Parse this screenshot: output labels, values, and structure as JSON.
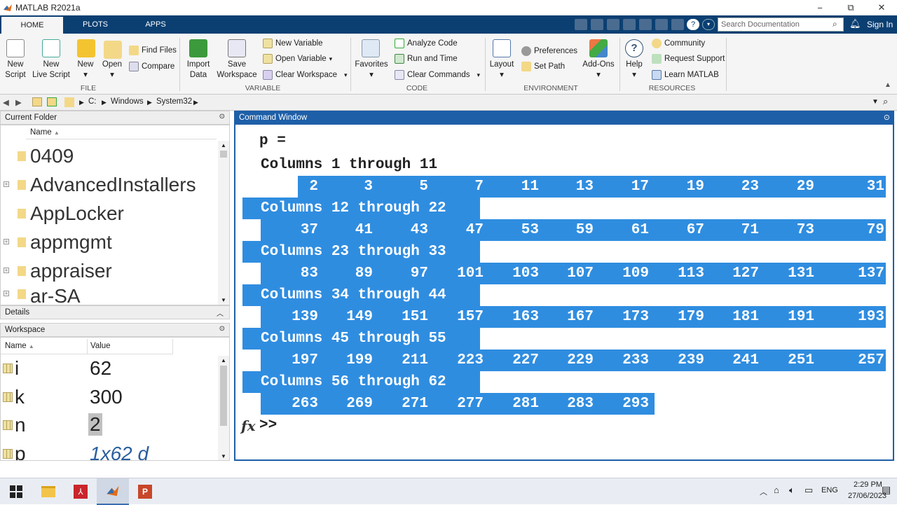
{
  "window": {
    "title": "MATLAB R2021a",
    "controls": {
      "minimize": "−",
      "maximize": "⧉",
      "close": "✕"
    }
  },
  "tabs": [
    "HOME",
    "PLOTS",
    "APPS"
  ],
  "search": {
    "placeholder": "Search Documentation"
  },
  "account": {
    "sign_in": "Sign In"
  },
  "ribbon": {
    "file": {
      "new_script": [
        "New",
        "Script"
      ],
      "new_live_script": [
        "New",
        "Live Script"
      ],
      "new": "New",
      "open": "Open",
      "find_files": "Find Files",
      "compare": "Compare",
      "label": "FILE"
    },
    "variable": {
      "import_data": [
        "Import",
        "Data"
      ],
      "save_workspace": [
        "Save",
        "Workspace"
      ],
      "new_variable": "New Variable",
      "open_variable": "Open Variable",
      "clear_workspace": "Clear Workspace",
      "label": "VARIABLE"
    },
    "code": {
      "favorites": "Favorites",
      "analyze_code": "Analyze Code",
      "run_and_time": "Run and Time",
      "clear_commands": "Clear Commands",
      "label": "CODE"
    },
    "environment": {
      "layout": "Layout",
      "preferences": "Preferences",
      "set_path": "Set Path",
      "addons": "Add-Ons",
      "label": "ENVIRONMENT"
    },
    "resources": {
      "help": "Help",
      "community": "Community",
      "request_support": "Request Support",
      "learn_matlab": "Learn MATLAB",
      "label": "RESOURCES"
    }
  },
  "address": {
    "path": [
      "C:",
      "Windows",
      "System32"
    ]
  },
  "current_folder": {
    "title": "Current Folder",
    "column": "Name",
    "items": [
      "0409",
      "AdvancedInstallers",
      "AppLocker",
      "appmgmt",
      "appraiser",
      "ar-SA"
    ]
  },
  "details": {
    "title": "Details"
  },
  "workspace": {
    "title": "Workspace",
    "columns": [
      "Name",
      "Value"
    ],
    "rows": [
      {
        "name": "i",
        "value": "62"
      },
      {
        "name": "k",
        "value": "300"
      },
      {
        "name": "n",
        "value": "2"
      },
      {
        "name": "p",
        "value": "1x62 d"
      }
    ]
  },
  "command_window": {
    "title": "Command Window",
    "var_line": "p =",
    "blocks": [
      {
        "header": "Columns 1 through 11",
        "values": [
          "2",
          "3",
          "5",
          "7",
          "11",
          "13",
          "17",
          "19",
          "23",
          "29",
          "31"
        ]
      },
      {
        "header": "Columns 12 through 22",
        "values": [
          "37",
          "41",
          "43",
          "47",
          "53",
          "59",
          "61",
          "67",
          "71",
          "73",
          "79"
        ]
      },
      {
        "header": "Columns 23 through 33",
        "values": [
          "83",
          "89",
          "97",
          "101",
          "103",
          "107",
          "109",
          "113",
          "127",
          "131",
          "137"
        ]
      },
      {
        "header": "Columns 34 through 44",
        "values": [
          "139",
          "149",
          "151",
          "157",
          "163",
          "167",
          "173",
          "179",
          "181",
          "191",
          "193"
        ]
      },
      {
        "header": "Columns 45 through 55",
        "values": [
          "197",
          "199",
          "211",
          "223",
          "227",
          "229",
          "233",
          "239",
          "241",
          "251",
          "257"
        ]
      },
      {
        "header": "Columns 56 through 62",
        "values": [
          "263",
          "269",
          "271",
          "277",
          "281",
          "283",
          "293"
        ]
      }
    ],
    "prompt": ">>",
    "fx": "fx"
  },
  "taskbar": {
    "language": "ENG",
    "time": "2:29 PM",
    "date": "27/06/2023"
  }
}
